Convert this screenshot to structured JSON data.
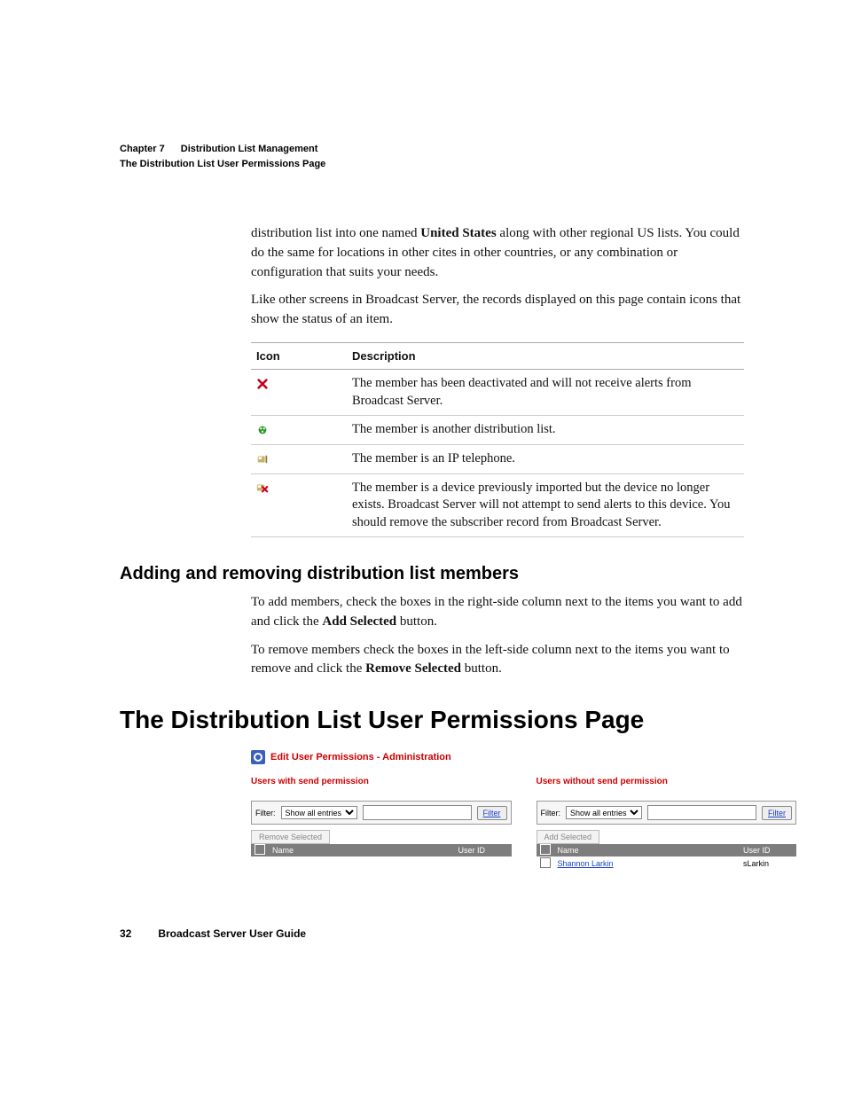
{
  "header": {
    "chapter_label": "Chapter 7",
    "chapter_title": "Distribution List Management",
    "page_context": "The Distribution List User Permissions Page"
  },
  "body": {
    "para1_pre": "distribution list into one named ",
    "para1_bold": "United States",
    "para1_post": " along with other regional US lists. You could do the same for locations in other cites in other countries, or any combination or configuration that suits your needs.",
    "para2": "Like other screens in Broadcast Server, the records displayed on this page contain icons that show the status of an item."
  },
  "icon_table": {
    "col_icon": "Icon",
    "col_desc": "Description",
    "rows": [
      {
        "icon": "deactivated-icon",
        "desc": "The member has been deactivated and will not receive alerts from Broadcast Server."
      },
      {
        "icon": "distribution-list-icon",
        "desc": "The member is another distribution list."
      },
      {
        "icon": "ip-phone-icon",
        "desc": "The member is an IP telephone."
      },
      {
        "icon": "missing-device-icon",
        "desc": "The member is a device previously imported but the device no longer exists. Broadcast Server will not attempt to send alerts to this device. You should remove the subscriber record from Broadcast Server."
      }
    ]
  },
  "section_add_remove": {
    "heading": "Adding and removing distribution list members",
    "p1a": "To add members, check the boxes in the right-side column next to the items you want to add and click the ",
    "p1b": "Add Selected",
    "p1c": " button.",
    "p2a": "To remove members check the boxes in the left-side column next to the items you want to remove and click the ",
    "p2b": "Remove Selected",
    "p2c": " button."
  },
  "main_heading": "The Distribution List User Permissions Page",
  "screenshot": {
    "title": "Edit User Permissions - Administration",
    "left": {
      "caption": "Users with send permission",
      "filter_label": "Filter:",
      "filter_option": "Show all entries",
      "filter_button": "Filter",
      "action_button": "Remove Selected",
      "col_name": "Name",
      "col_id": "User ID"
    },
    "right": {
      "caption": "Users without send permission",
      "filter_label": "Filter:",
      "filter_option": "Show all entries",
      "filter_button": "Filter",
      "action_button": "Add Selected",
      "col_name": "Name",
      "col_id": "User ID",
      "row1_name": "Shannon Larkin",
      "row1_id": "sLarkin"
    }
  },
  "footer": {
    "page_number": "32",
    "doc_title": "Broadcast Server User Guide"
  }
}
